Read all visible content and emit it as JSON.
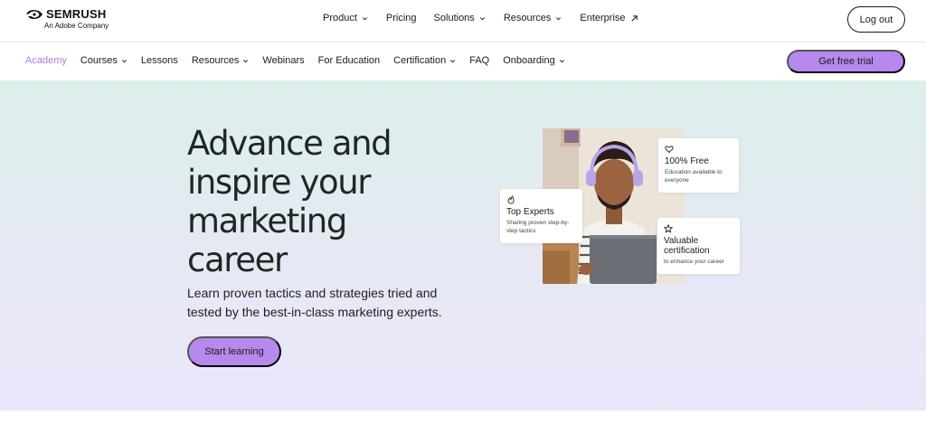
{
  "header": {
    "brand": "SEMRUSH",
    "brand_sub": "An Adobe Company",
    "nav": [
      {
        "label": "Product",
        "dropdown": true
      },
      {
        "label": "Pricing",
        "dropdown": false
      },
      {
        "label": "Solutions",
        "dropdown": true
      },
      {
        "label": "Resources",
        "dropdown": true
      },
      {
        "label": "Enterprise",
        "external": true
      }
    ],
    "logout_label": "Log out"
  },
  "academy_nav": {
    "items": [
      {
        "label": "Academy",
        "active": true
      },
      {
        "label": "Courses",
        "dropdown": true
      },
      {
        "label": "Lessons"
      },
      {
        "label": "Resources",
        "dropdown": true
      },
      {
        "label": "Webinars"
      },
      {
        "label": "For Education"
      },
      {
        "label": "Certification",
        "dropdown": true
      },
      {
        "label": "FAQ"
      },
      {
        "label": "Onboarding",
        "dropdown": true
      }
    ],
    "cta_label": "Get free trial"
  },
  "hero": {
    "title_lines": [
      "Advance and",
      "inspire your",
      "marketing",
      "career"
    ],
    "subtitle": "Learn proven tactics and strategies tried and tested by the best-in-class marketing experts.",
    "cta_label": "Start learning",
    "cards": {
      "free": {
        "icon": "heart-icon",
        "title": "100% Free",
        "desc": "Education available to everyone"
      },
      "experts": {
        "icon": "flame-icon",
        "title": "Top Experts",
        "desc": "Sharing proven step-by-step tactics"
      },
      "cert": {
        "icon": "star-icon",
        "title": "Valuable certification",
        "desc": "to enhance your career"
      }
    }
  },
  "colors": {
    "accent": "#b589ee",
    "active_link": "#a77fe0",
    "hero_top": "#dcefeb",
    "hero_bottom": "#eae6fb"
  }
}
